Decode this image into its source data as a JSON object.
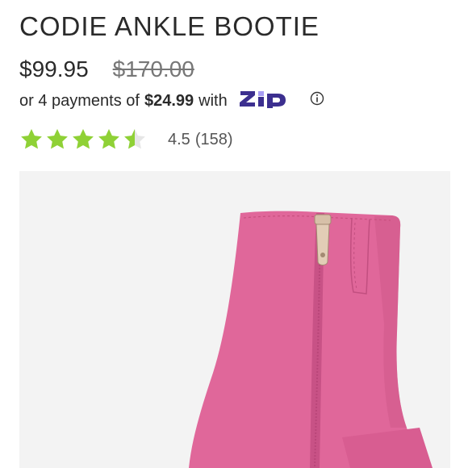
{
  "product": {
    "title": "CODIE ANKLE BOOTIE",
    "price": "$99.95",
    "original_price": "$170.00",
    "installments": {
      "prefix": "or 4 payments of",
      "amount": "$24.99",
      "suffix": "with",
      "provider_logo_text": "ZIP",
      "info_icon": "info-circle-icon"
    },
    "rating": {
      "value": 4.5,
      "value_label": "4.5",
      "count_label": "(158)",
      "max": 5,
      "star_color": "#8fd136"
    },
    "image": {
      "alt": "pink suede ankle bootie with side zipper",
      "boot_color": "#e0679a",
      "background": "#f3f3f3"
    }
  },
  "colors": {
    "text": "#2a2a2a",
    "zip_purple": "#3c2f8f",
    "zip_lilac": "#a89df3",
    "star_green": "#8fd136"
  }
}
